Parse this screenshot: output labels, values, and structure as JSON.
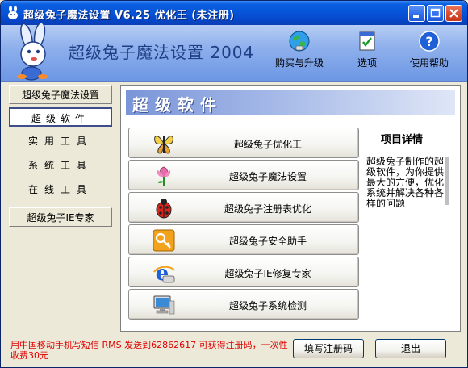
{
  "window": {
    "title": "超级兔子魔法设置  V6.25 优化王  (未注册)"
  },
  "header": {
    "brand": "超级兔子魔法设置 2004",
    "tools": [
      {
        "label": "购买与升级",
        "icon": "globe-icon"
      },
      {
        "label": "选项",
        "icon": "checklist-icon"
      },
      {
        "label": "使用帮助",
        "icon": "help-icon"
      }
    ]
  },
  "nav": {
    "items": [
      {
        "label": "超级兔子魔法设置",
        "style": "boxed"
      },
      {
        "label": "超级软件",
        "style": "selected"
      },
      {
        "label": "实用工具",
        "style": "plain"
      },
      {
        "label": "系统工具",
        "style": "plain"
      },
      {
        "label": "在线工具",
        "style": "plain"
      },
      {
        "label": "超级兔子IE专家",
        "style": "boxed"
      }
    ]
  },
  "panel": {
    "heading": "超级软件",
    "products": [
      {
        "label": "超级兔子优化王",
        "icon": "butterfly-icon"
      },
      {
        "label": "超级兔子魔法设置",
        "icon": "flower-icon"
      },
      {
        "label": "超级兔子注册表优化",
        "icon": "ladybug-icon"
      },
      {
        "label": "超级兔子安全助手",
        "icon": "key-icon"
      },
      {
        "label": "超级兔子IE修复专家",
        "icon": "ie-icon"
      },
      {
        "label": "超级兔子系统检测",
        "icon": "monitor-icon"
      }
    ],
    "details_title": "项目详情",
    "details_text": "超级兔子制作的超级软件，为你提供最大的方便，优化系统并解决各种各样的问题"
  },
  "footer": {
    "promo": "用中国移动手机写短信 RMS 发送到62862617 可获得注册码，一次性收费30元",
    "register_label": "填写注册码",
    "exit_label": "退出"
  },
  "colors": {
    "titlebar": "#0754d8",
    "header": "#8eb0ec",
    "promo": "#e00000"
  }
}
